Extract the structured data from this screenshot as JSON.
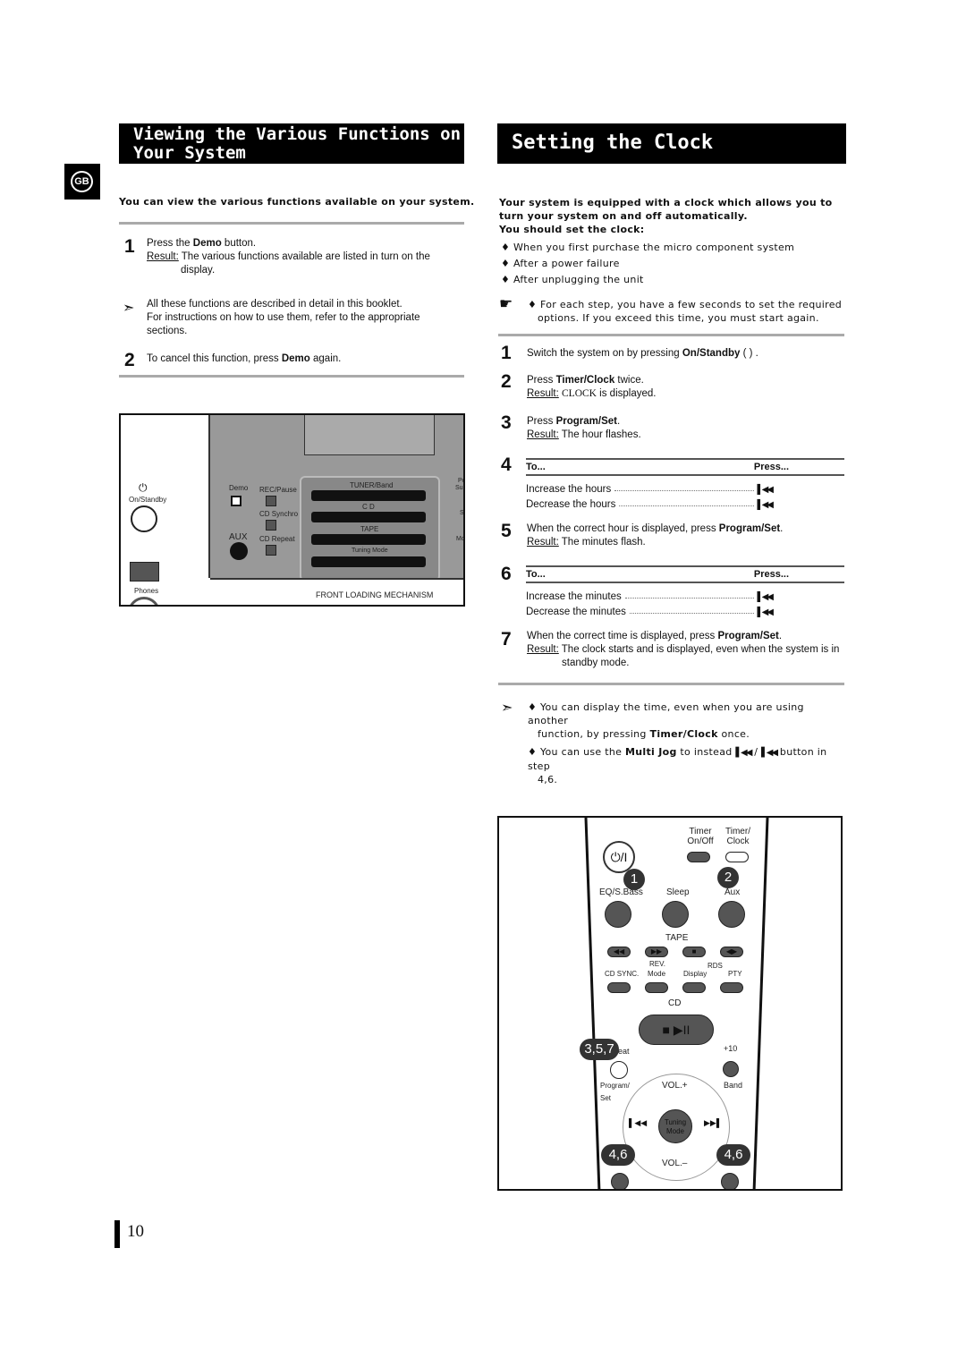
{
  "badge": "GB",
  "left": {
    "title_line1": "Viewing the Various Functions on",
    "title_line2": "Your System",
    "intro": "You can view the various functions available on your system.",
    "step1": {
      "num": "1",
      "text_a": "Press the ",
      "bold": "Demo",
      "text_b": " button.",
      "result_label": "Result:",
      "result": " The various functions available are listed in turn on the",
      "result2": "display."
    },
    "note": {
      "line1": "All these functions are described in detail in this booklet.",
      "line2": "For instructions on how to use them, refer to the appropriate",
      "line3": "sections."
    },
    "step2": {
      "num": "2",
      "text_a": "To cancel this function, press ",
      "bold": "Demo",
      "text_b": " again."
    },
    "device": {
      "on_standby": "On/Standby",
      "phones": "Phones",
      "demo": "Demo",
      "rec_pause": "REC/Pause",
      "cd_synchro": "CD Synchro",
      "cd_repeat": "CD Repeat",
      "aux": "AUX",
      "tuner_band": "TUNER/Band",
      "cd": "C D",
      "tape": "TAPE",
      "tuning_mode": "Tuning Mode",
      "front_loading": "FRONT LOADING MECHANISM",
      "edge1": "Po",
      "edge1b": "Sur",
      "edge2": "Sl",
      "edge3": "Mo"
    }
  },
  "right": {
    "title": "Setting the Clock",
    "intro1": "Your system is equipped with a clock which allows you to",
    "intro2": "turn your system on and off automatically.",
    "intro3": "You should set the clock:",
    "bullets": [
      "When you first purchase the micro component system",
      "After a power failure",
      "After unplugging the unit"
    ],
    "tip1": "For each step, you have a few seconds to set the required",
    "tip2": "options. If you exceed this time, you must start again.",
    "steps": {
      "s1": {
        "num": "1",
        "a": "Switch the system on by pressing ",
        "b": "On/Standby",
        "c": " (  ) ."
      },
      "s2": {
        "num": "2",
        "a": "Press ",
        "b": "Timer/Clock",
        "c": " twice.",
        "result_label": "Result:",
        "result_a": " ",
        "result_b": "CLOCK",
        "result_c": " is displayed."
      },
      "s3": {
        "num": "3",
        "a": "Press ",
        "b": "Program/Set",
        "c": ".",
        "result_label": "Result:",
        "result": " The hour flashes."
      },
      "s4": {
        "num": "4",
        "col_to": "To...",
        "col_press": "Press...",
        "rows": [
          "Increase the hours",
          "Decrease the hours"
        ]
      },
      "s5": {
        "num": "5",
        "a": "When the correct hour is displayed, press ",
        "b": "Program/Set",
        "c": ".",
        "result_label": "Result:",
        "result": " The minutes flash."
      },
      "s6": {
        "num": "6",
        "col_to": "To...",
        "col_press": "Press...",
        "rows": [
          "Increase the minutes",
          "Decrease the minutes"
        ]
      },
      "s7": {
        "num": "7",
        "a": "When the correct time is displayed, press ",
        "b": "Program/Set",
        "c": ".",
        "result_label": "Result:",
        "result": " The clock starts and is displayed, even when the system is in",
        "result2": "standby mode."
      }
    },
    "notes": {
      "n1a": "You can display the time, even when you are using another",
      "n1b": "function, by pressing ",
      "n1c": "Timer/Clock",
      "n1d": " once.",
      "n2a": "You can use the ",
      "n2b": "Multi Jog",
      "n2c": " to instead",
      "n2d": " button in step",
      "n2e": "4,6."
    },
    "remote": {
      "timer_onoff": "Timer On/Off",
      "timer_clock": "Timer/ Clock",
      "eq": "EQ/S.Bass",
      "sleep": "Sleep",
      "aux": "Aux",
      "tape": "TAPE",
      "rev": "REV.",
      "mode": "Mode",
      "rds": "RDS",
      "cd_sync": "CD SYNC.",
      "display": "Display",
      "pty": "PTY",
      "cd": "CD",
      "repeat": "eat",
      "plus10": "+10",
      "program": "Program/",
      "set": "Set",
      "band": "Band",
      "vol_up": "VOL.+",
      "vol_down": "VOL.–",
      "tuning": "Tuning",
      "tmode": "Mode",
      "b1": "1",
      "b2": "2",
      "b357": "3,5,7",
      "b46a": "4,6",
      "b46b": "4,6"
    }
  },
  "page_number": "10"
}
